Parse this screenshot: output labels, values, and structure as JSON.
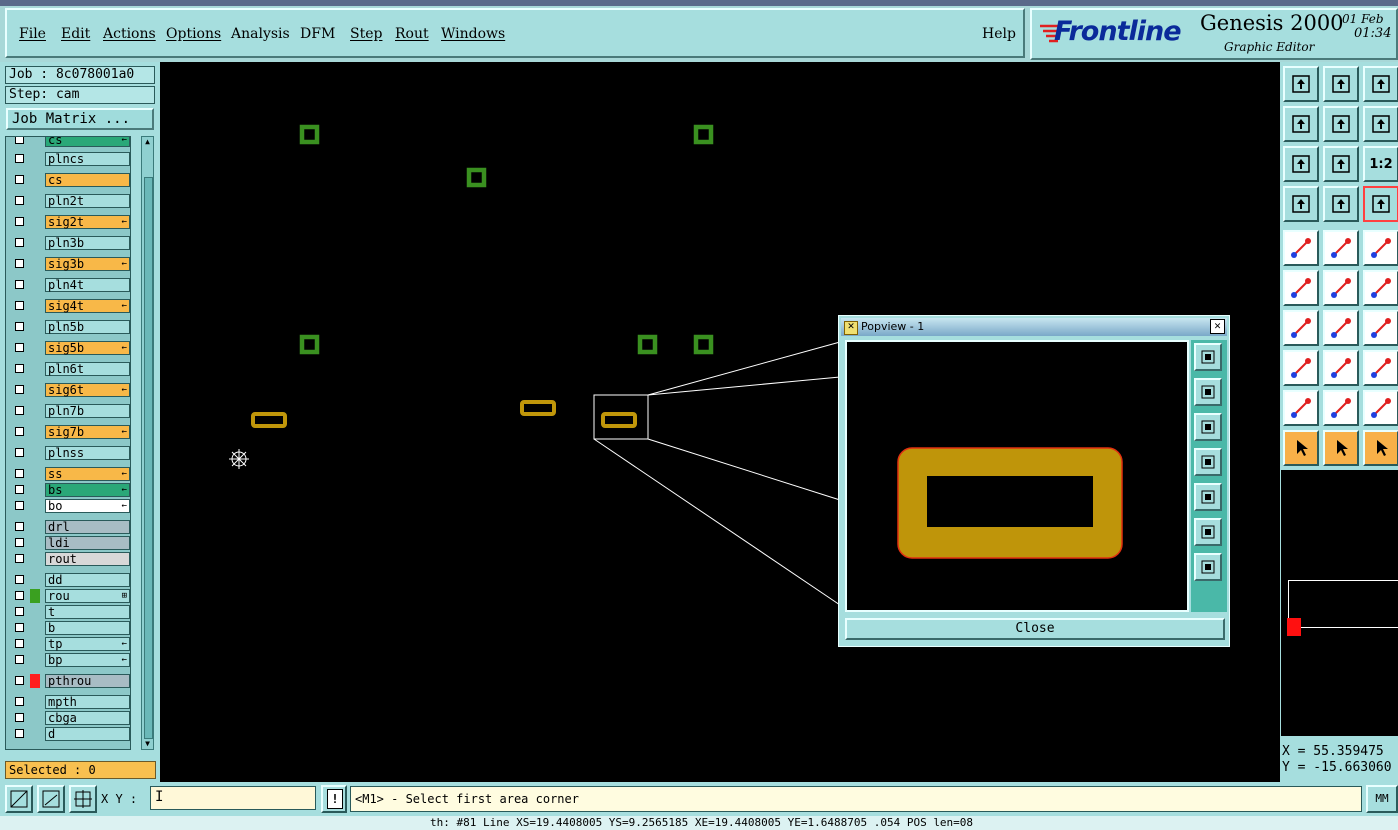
{
  "menu": {
    "items": [
      "File",
      "Edit",
      "Actions",
      "Options",
      "Analysis",
      "DFM",
      "Step",
      "Rout",
      "Windows"
    ],
    "help": "Help"
  },
  "brand": {
    "logo": "Frontline",
    "product": "Genesis 2000",
    "subtitle": "Graphic Editor",
    "date": "01 Feb",
    "time": "01:34"
  },
  "job": {
    "job_label": "Job : 8c078001a0",
    "step_label": "Step: cam",
    "matrix_button": "Job Matrix ..."
  },
  "layers": [
    {
      "name": "cs",
      "color": "#2aa878",
      "mark": "←"
    },
    {
      "name": "plncs",
      "color": "#a6dede",
      "mark": ""
    },
    {
      "name": "cs",
      "color": "#f8b848",
      "mark": ""
    },
    {
      "name": "pln2t",
      "color": "#a6dede",
      "mark": ""
    },
    {
      "name": "sig2t",
      "color": "#f8b848",
      "mark": "←"
    },
    {
      "name": "pln3b",
      "color": "#a6dede",
      "mark": ""
    },
    {
      "name": "sig3b",
      "color": "#f8b848",
      "mark": "←"
    },
    {
      "name": "pln4t",
      "color": "#a6dede",
      "mark": ""
    },
    {
      "name": "sig4t",
      "color": "#f8b848",
      "mark": "←"
    },
    {
      "name": "pln5b",
      "color": "#a6dede",
      "mark": ""
    },
    {
      "name": "sig5b",
      "color": "#f8b848",
      "mark": "←"
    },
    {
      "name": "pln6t",
      "color": "#a6dede",
      "mark": ""
    },
    {
      "name": "sig6t",
      "color": "#f8b848",
      "mark": "←"
    },
    {
      "name": "pln7b",
      "color": "#a6dede",
      "mark": ""
    },
    {
      "name": "sig7b",
      "color": "#f8b848",
      "mark": "←"
    },
    {
      "name": "plnss",
      "color": "#a6dede",
      "mark": ""
    },
    {
      "name": "ss",
      "color": "#f8b848",
      "mark": "←"
    },
    {
      "name": "bs",
      "color": "#2aa878",
      "mark": "←"
    },
    {
      "name": "bo",
      "color": "#ffffff",
      "mark": "←"
    },
    {
      "name": "drl",
      "color": "#a8bcc4",
      "mark": ""
    },
    {
      "name": "ldi",
      "color": "#a8bcc4",
      "mark": ""
    },
    {
      "name": "rout",
      "color": "#d8d8d8",
      "mark": ""
    },
    {
      "name": "dd",
      "color": "#a6dede",
      "mark": ""
    },
    {
      "name": "rou",
      "color": "#a6dede",
      "mark": "⊞",
      "swatch": "#3aa020"
    },
    {
      "name": "t",
      "color": "#a6dede",
      "mark": ""
    },
    {
      "name": "b",
      "color": "#a6dede",
      "mark": ""
    },
    {
      "name": "tp",
      "color": "#a6dede",
      "mark": "←"
    },
    {
      "name": "bp",
      "color": "#a6dede",
      "mark": "←"
    },
    {
      "name": "pthrou",
      "color": "#a8bcc4",
      "mark": "",
      "swatch": "#ff2020"
    },
    {
      "name": "mpth",
      "color": "#a6dede",
      "mark": ""
    },
    {
      "name": "cbga",
      "color": "#a6dede",
      "mark": ""
    },
    {
      "name": "d",
      "color": "#a6dede",
      "mark": ""
    }
  ],
  "selected": "Selected : 0",
  "popview": {
    "title": "Popview - 1",
    "close_button": "Close"
  },
  "coords": {
    "x": "X = 55.359475",
    "y": "Y = -15.663060"
  },
  "bottom": {
    "xy_label": "X Y :",
    "xy_value": "",
    "prompt": "<M1> - Select first area corner",
    "units_button": "MM"
  },
  "status_line": "th:  #81 Line  XS=19.4408005 YS=9.2565185 XE=19.4408005 YE=1.6488705  .054 POS  len=08"
}
